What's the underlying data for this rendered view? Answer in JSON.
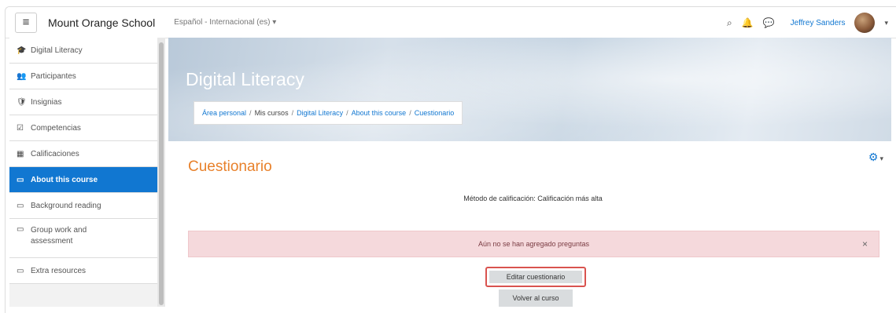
{
  "navbar": {
    "menu_icon": "hamburger-icon",
    "site_name": "Mount Orange School",
    "language": "Español - Internacional (es) ▾",
    "search_icon": "search-icon",
    "notifications_icon": "bell-icon",
    "messages_icon": "chat-icon",
    "user_name": "Jeffrey Sanders",
    "user_menu_caret": "▾"
  },
  "sidebar": {
    "items": [
      {
        "icon": "graduation-cap-icon",
        "glyph": "🎓",
        "label": "Digital Literacy"
      },
      {
        "icon": "users-icon",
        "glyph": "👥",
        "label": "Participantes"
      },
      {
        "icon": "badge-icon",
        "glyph": "🛡",
        "label": "Insignias"
      },
      {
        "icon": "checkbox-icon",
        "glyph": "☑",
        "label": "Competencias"
      },
      {
        "icon": "table-icon",
        "glyph": "▦",
        "label": "Calificaciones"
      },
      {
        "icon": "folder-icon",
        "glyph": "▭",
        "label": "About this course"
      },
      {
        "icon": "folder-icon",
        "glyph": "▭",
        "label": "Background reading"
      },
      {
        "icon": "folder-icon",
        "glyph": "▭",
        "label": "Group work and assessment"
      },
      {
        "icon": "folder-icon",
        "glyph": "▭",
        "label": "Extra resources"
      }
    ]
  },
  "header": {
    "course_title": "Digital Literacy",
    "breadcrumb": [
      "Área personal",
      "Mis cursos",
      "Digital Literacy",
      "About this course",
      "Cuestionario"
    ],
    "breadcrumb_sep": "/"
  },
  "main": {
    "title": "Cuestionario",
    "settings_icon": "gear-icon",
    "grading_method": "Método de calificación: Calificación más alta",
    "alert_text": "Aún no se han agregado preguntas",
    "alert_close": "×",
    "edit_button": "Editar cuestionario",
    "back_button": "Volver al curso"
  },
  "colors": {
    "accent": "#1177d1",
    "title_orange": "#e8812b",
    "alert_bg": "#f5d9dc",
    "highlight_border": "#d9534f"
  }
}
